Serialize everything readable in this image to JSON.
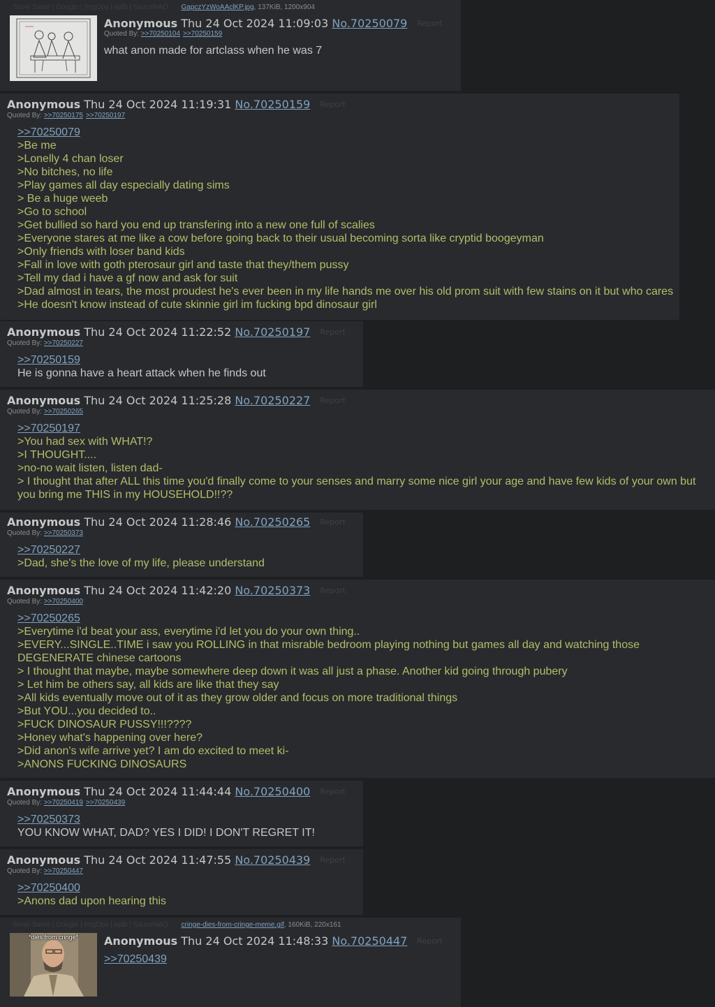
{
  "common": {
    "name": "Anonymous",
    "report": "Report",
    "quoted_by": "Quoted By:",
    "file_options": [
      "Show Same",
      "Google",
      "ImgOps",
      "iqdb",
      "SauceNAO"
    ]
  },
  "posts": [
    {
      "date": "Thu 24 Oct 2024 11:09:03",
      "num": "No.70250079",
      "file": {
        "name": "GapczYzWoAAclKP.jpg",
        "meta": ", 137KiB, 1200x904"
      },
      "quoted_by": [
        ">>70250104",
        ">>70250159"
      ],
      "lines": [
        {
          "t": "what anon made for artclass when he was 7",
          "k": "plain"
        }
      ]
    },
    {
      "date": "Thu 24 Oct 2024 11:19:31",
      "num": "No.70250159",
      "quoted_by": [
        ">>70250175",
        ">>70250197"
      ],
      "lines": [
        {
          "t": ">>70250079",
          "k": "link"
        },
        {
          "t": ">Be me",
          "k": "quote"
        },
        {
          "t": ">Lonelly 4 chan loser",
          "k": "quote"
        },
        {
          "t": ">No bitches, no life",
          "k": "quote"
        },
        {
          "t": ">Play games all day especially dating sims",
          "k": "quote"
        },
        {
          "t": "> Be a huge weeb",
          "k": "quote"
        },
        {
          "t": ">Go to school",
          "k": "quote"
        },
        {
          "t": ">Get bullied so hard you end up transfering into a new one full of scalies",
          "k": "quote"
        },
        {
          "t": ">Everyone stares at me like a cow before going back to their usual becoming sorta like cryptid boogeyman",
          "k": "quote"
        },
        {
          "t": ">Only friends with loser band kids",
          "k": "quote"
        },
        {
          "t": ">Fall in love with goth pterosaur girl and taste that they/them pussy",
          "k": "quote"
        },
        {
          "t": ">Tell my dad i have a gf now and ask for suit",
          "k": "quote"
        },
        {
          "t": ">Dad almost in tears, the most proudest he's ever been in my life hands me over his old prom suit with few stains on it but who cares",
          "k": "quote"
        },
        {
          "t": ">He doesn't know instead of cute skinnie girl im fucking bpd dinosaur girl",
          "k": "quote"
        }
      ]
    },
    {
      "date": "Thu 24 Oct 2024 11:22:52",
      "num": "No.70250197",
      "quoted_by": [
        ">>70250227"
      ],
      "lines": [
        {
          "t": ">>70250159",
          "k": "link"
        },
        {
          "t": "He is gonna have a heart attack when he finds out",
          "k": "plain"
        }
      ]
    },
    {
      "date": "Thu 24 Oct 2024 11:25:28",
      "num": "No.70250227",
      "quoted_by": [
        ">>70250265"
      ],
      "lines": [
        {
          "t": ">>70250197",
          "k": "link"
        },
        {
          "t": ">You had sex with WHAT!?",
          "k": "quote"
        },
        {
          "t": ">I THOUGHT....",
          "k": "quote"
        },
        {
          "t": ">no-no wait listen, listen dad-",
          "k": "quote"
        },
        {
          "t": "> I thought that after ALL this time you'd finally come to your senses and marry some nice girl your age and have few kids of your own but you bring me THIS in my HOUSEHOLD!!??",
          "k": "quote"
        }
      ]
    },
    {
      "date": "Thu 24 Oct 2024 11:28:46",
      "num": "No.70250265",
      "quoted_by": [
        ">>70250373"
      ],
      "lines": [
        {
          "t": ">>70250227",
          "k": "link"
        },
        {
          "t": ">Dad, she's the love of my life, please understand",
          "k": "quote"
        }
      ]
    },
    {
      "date": "Thu 24 Oct 2024 11:42:20",
      "num": "No.70250373",
      "quoted_by": [
        ">>70250400"
      ],
      "lines": [
        {
          "t": ">>70250265",
          "k": "link"
        },
        {
          "t": ">Everytime i'd beat your ass, everytime i'd let you do your own thing..",
          "k": "quote"
        },
        {
          "t": ">EVERY...SINGLE..TIME i saw you ROLLING in that misrable bedroom playing nothing but games all day and watching those DEGENERATE chinese cartoons",
          "k": "quote"
        },
        {
          "t": "> I thought that maybe, maybe somewhere deep down it was all just a phase. Another kid going through pubery",
          "k": "quote"
        },
        {
          "t": "> Let him be others say, all kids are like that they say",
          "k": "quote"
        },
        {
          "t": ">All kids eventually move out of it as they grow older and focus on more traditional things",
          "k": "quote"
        },
        {
          "t": ">But YOU...you decided to..",
          "k": "quote"
        },
        {
          "t": ">FUCK DINOSAUR PUSSY!!!????",
          "k": "quote"
        },
        {
          "t": ">Honey what's happening over here?",
          "k": "quote"
        },
        {
          "t": ">Did anon's wife arrive yet? I am do excited to meet ki-",
          "k": "quote"
        },
        {
          "t": ">ANONS FUCKING DINOSAURS",
          "k": "quote"
        }
      ]
    },
    {
      "date": "Thu 24 Oct 2024 11:44:44",
      "num": "No.70250400",
      "quoted_by": [
        ">>70250419",
        ">>70250439"
      ],
      "lines": [
        {
          "t": ">>70250373",
          "k": "link"
        },
        {
          "t": "YOU KNOW WHAT, DAD? YES I DID! I DON'T REGRET IT!",
          "k": "plain"
        }
      ]
    },
    {
      "date": "Thu 24 Oct 2024 11:47:55",
      "num": "No.70250439",
      "quoted_by": [
        ">>70250447"
      ],
      "lines": [
        {
          "t": ">>70250400",
          "k": "link"
        },
        {
          "t": ">Anons dad upon hearing this",
          "k": "quote"
        }
      ]
    },
    {
      "date": "Thu 24 Oct 2024 11:48:33",
      "num": "No.70250447",
      "file": {
        "name": "cringe-dies-from-cringe-meme.gif",
        "meta": ", 160KiB, 220x161",
        "caption": "*dies from cringe*"
      },
      "quoted_by": [],
      "lines": [
        {
          "t": ">>70250439",
          "k": "link"
        }
      ]
    }
  ]
}
